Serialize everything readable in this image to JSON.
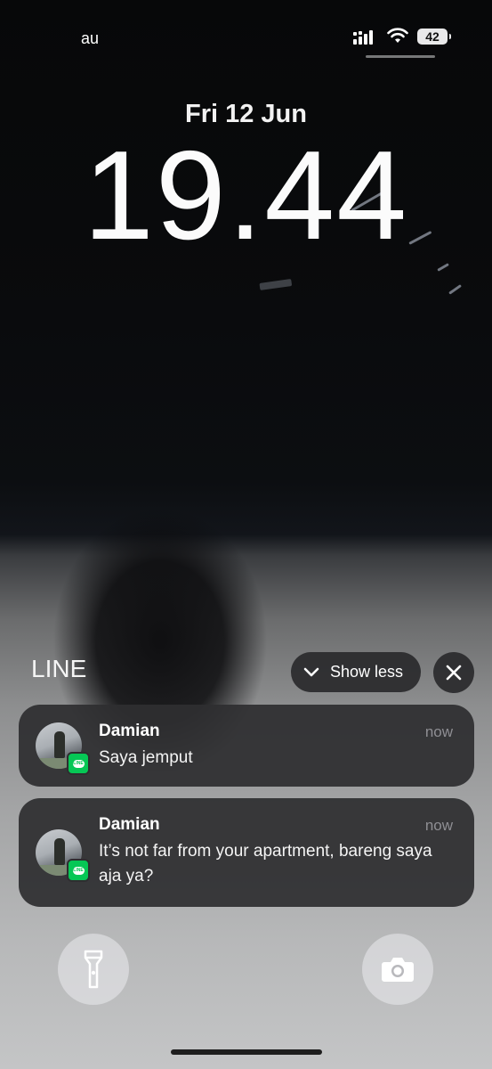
{
  "status_bar": {
    "carrier": "au",
    "battery_level": "42",
    "icons": [
      "signal-icon",
      "wifi-icon",
      "battery-icon"
    ]
  },
  "lock_screen": {
    "date": "Fri 12 Jun",
    "time": "19.44"
  },
  "notification_group": {
    "app_name": "LINE",
    "show_less_label": "Show less",
    "notifications": [
      {
        "sender": "Damian",
        "time": "now",
        "message": "Saya jemput"
      },
      {
        "sender": "Damian",
        "time": "now",
        "message": "It’s not far from your apartment, bareng saya aja ya?"
      }
    ]
  },
  "quick_actions": [
    "flashlight-icon",
    "camera-icon"
  ],
  "colors": {
    "app_badge": "#06c755",
    "notification_bg": "#2e2e30",
    "timestamp": "#8e8e93"
  }
}
